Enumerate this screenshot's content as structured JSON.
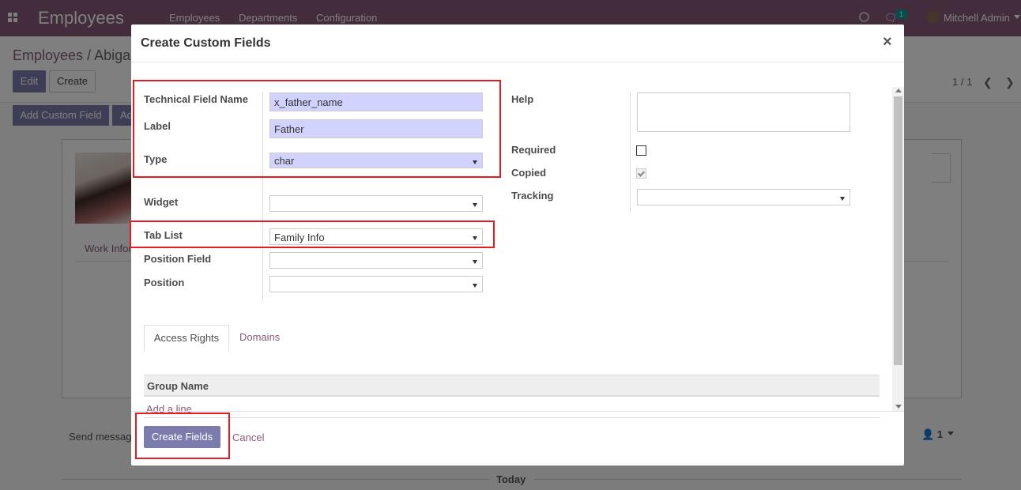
{
  "topbar": {
    "app_name": "Employees",
    "menu": [
      "Employees",
      "Departments",
      "Configuration"
    ],
    "chat_badge": "1",
    "user": "Mitchell Admin"
  },
  "control_panel": {
    "breadcrumb_root": "Employees",
    "breadcrumb_sep": "/",
    "breadcrumb_current": "Abiga",
    "edit_label": "Edit",
    "create_label": "Create",
    "pager": "1 / 1"
  },
  "actions": {
    "add_custom_field": "Add Custom Field",
    "second": "Ad"
  },
  "sheet": {
    "work_info_tab": "Work Infor"
  },
  "chatter": {
    "send_message": "Send messag",
    "followers": "1",
    "today": "Today"
  },
  "modal": {
    "title": "Create Custom Fields",
    "close": "×",
    "fields": {
      "technical_name": {
        "label": "Technical Field Name",
        "value": "x_father_name"
      },
      "label": {
        "label": "Label",
        "value": "Father"
      },
      "type": {
        "label": "Type",
        "value": "char"
      },
      "widget": {
        "label": "Widget",
        "value": ""
      },
      "tab_list": {
        "label": "Tab List",
        "value": "Family Info"
      },
      "position_field": {
        "label": "Position Field",
        "value": ""
      },
      "position": {
        "label": "Position",
        "value": ""
      },
      "help": {
        "label": "Help",
        "value": ""
      },
      "required": {
        "label": "Required",
        "checked": false
      },
      "copied": {
        "label": "Copied",
        "checked": true
      },
      "tracking": {
        "label": "Tracking",
        "value": ""
      }
    },
    "tabs": [
      "Access Rights",
      "Domains"
    ],
    "table": {
      "columns": [
        "Group Name"
      ],
      "add_line": "Add a line"
    },
    "footer": {
      "create_fields": "Create Fields",
      "cancel": "Cancel"
    }
  },
  "colors": {
    "brand": "#875a7b",
    "primary_button": "#7c7bad",
    "required_field": "#d2d2ff",
    "highlight": "#e31b23"
  }
}
